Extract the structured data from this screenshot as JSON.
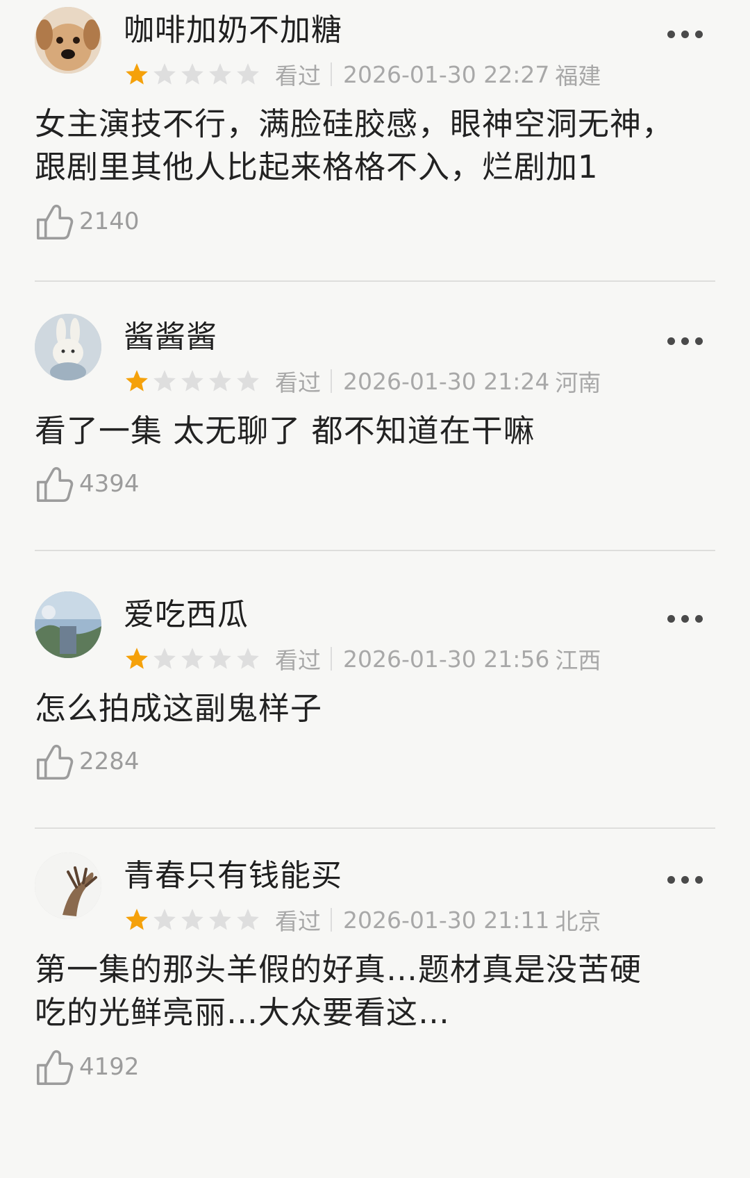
{
  "watched_label": "看过",
  "reviews": [
    {
      "user": "咖啡加奶不加糖",
      "rating": 1,
      "datetime": "2026-01-30 22:27",
      "location": "福建",
      "comment_lines": [
        "女主演技不行，满脸硅胶感，眼神空洞无神，",
        "跟剧里其他人比起来格格不入，烂剧加1"
      ],
      "likes": "2140"
    },
    {
      "user": "酱酱酱",
      "rating": 1,
      "datetime": "2026-01-30 21:24",
      "location": "河南",
      "comment_lines": [
        "看了一集 太无聊了 都不知道在干嘛"
      ],
      "likes": "4394"
    },
    {
      "user": "爱吃西瓜",
      "rating": 1,
      "datetime": "2026-01-30 21:56",
      "location": "江西",
      "comment_lines": [
        "怎么拍成这副鬼样子"
      ],
      "likes": "2284"
    },
    {
      "user": "青春只有钱能买",
      "rating": 1,
      "datetime": "2026-01-30 21:11",
      "location": "北京",
      "comment_lines": [
        "第一集的那头羊假的好真…题材真是没苦硬",
        "吃的光鲜亮丽…大众要看这…"
      ],
      "likes": "4192"
    }
  ],
  "colors": {
    "star_on": "#f5a10a",
    "star_off": "#dedede",
    "meta_text": "#a8a8a8",
    "background": "#f7f7f5"
  }
}
